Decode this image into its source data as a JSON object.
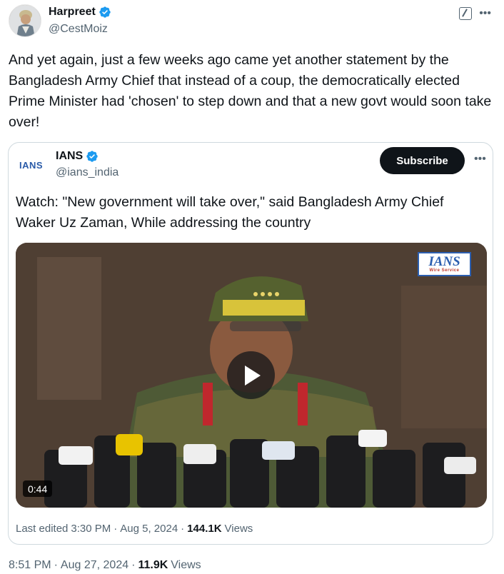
{
  "author": {
    "name": "Harpreet",
    "handle": "@CestMoiz"
  },
  "tweet": {
    "text": "And yet again, just a few weeks ago came yet another statement by the Bangladesh Army Chief that instead of a coup, the democratically elected Prime Minister had 'chosen' to step down and that a new govt would soon take over!",
    "time": "8:51 PM",
    "sep": "·",
    "date": "Aug 27, 2024",
    "views_count": "11.9K",
    "views_label": "Views"
  },
  "quoted": {
    "logo_text": "IANS",
    "name": "IANS",
    "handle": "@ians_india",
    "subscribe_label": "Subscribe",
    "text": "Watch: \"New government will take over,\" said Bangladesh Army Chief Waker Uz Zaman, While addressing the country",
    "video": {
      "watermark": "IANS",
      "watermark_sub": "Wire Service",
      "duration": "0:44"
    },
    "edited_label": "Last edited",
    "time": "3:30 PM",
    "sep": "·",
    "date": "Aug 5, 2024",
    "views_count": "144.1K",
    "views_label": "Views"
  },
  "icons": {
    "verified": "verified-badge-icon",
    "grok": "grok-icon",
    "more": "more-icon",
    "play": "play-icon"
  },
  "colors": {
    "verified": "#1d9bf0",
    "secondary_text": "#536471",
    "subscribe_bg": "#0f1419",
    "border": "#cfd9de"
  }
}
